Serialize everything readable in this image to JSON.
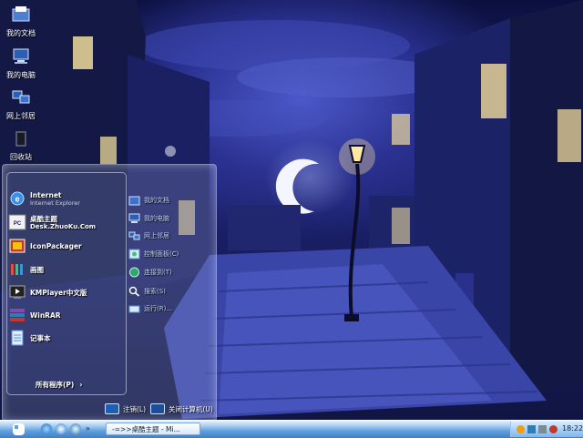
{
  "desktop": {
    "icons": [
      {
        "name": "doc-folder-icon",
        "label": "我的文档"
      },
      {
        "name": "computer-icon",
        "label": "我的电脑"
      },
      {
        "name": "network-icon",
        "label": "网上邻居"
      },
      {
        "name": "recycle-bin-icon",
        "label": "回收站"
      }
    ]
  },
  "start_menu": {
    "programs": [
      {
        "icon": "ie-icon",
        "title": "Internet",
        "subtitle": "Internet Explorer"
      },
      {
        "icon": "zhuoku-icon",
        "title": "桌酷主题",
        "subtitle": "Desk.ZhuoKu.Com"
      },
      {
        "icon": "iconpackager-icon",
        "title": "IconPackager",
        "subtitle": ""
      },
      {
        "icon": "paint-icon",
        "title": "画图",
        "subtitle": ""
      },
      {
        "icon": "kmplayer-icon",
        "title": "KMPlayer中文版",
        "subtitle": ""
      },
      {
        "icon": "winrar-icon",
        "title": "WinRAR",
        "subtitle": ""
      },
      {
        "icon": "notepad-icon",
        "title": "记事本",
        "subtitle": ""
      }
    ],
    "all_programs": "所有程序(P)",
    "places": [
      {
        "icon": "documents-icon",
        "label": "我的文档"
      },
      {
        "icon": "my-computer-icon",
        "label": "我的电脑"
      },
      {
        "icon": "network-places-icon",
        "label": "网上邻居"
      },
      {
        "icon": "control-panel-icon",
        "label": "控制面板(C)"
      },
      {
        "icon": "connect-to-icon",
        "label": "连接到(T)"
      },
      {
        "icon": "search-icon",
        "label": "搜索(S)"
      },
      {
        "icon": "run-icon",
        "label": "运行(R)..."
      }
    ],
    "logoff": "注销(L)",
    "shutdown": "关闭计算机(U)"
  },
  "taskbar": {
    "task_label": "-=>>桌酷主题 - Mi...",
    "clock": "18:22"
  },
  "colors": {
    "taskbar": "#5f9fdc",
    "wallpaper": "#1e2572",
    "lamp_glow": "#ffe9a0"
  }
}
